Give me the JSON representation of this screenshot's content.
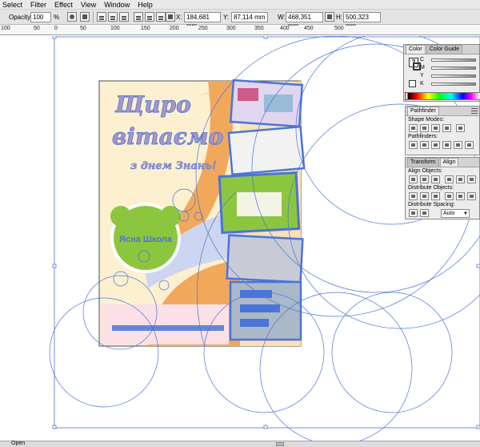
{
  "menu": [
    "Select",
    "Filter",
    "Effect",
    "View",
    "Window",
    "Help"
  ],
  "control": {
    "opacity_label": "Opacity:",
    "opacity_value": "100",
    "opacity_unit": "%",
    "x_label": "X:",
    "x_value": "184,681 mm",
    "y_label": "Y:",
    "y_value": "87,114 mm",
    "w_label": "W:",
    "w_value": "468,351 mm",
    "h_label": "H:",
    "h_value": "500,323 mm"
  },
  "ruler": [
    "100",
    "50",
    "0",
    "50",
    "100",
    "150",
    "200",
    "250",
    "300",
    "350",
    "400",
    "450",
    "500"
  ],
  "artwork": {
    "headline_line1": "Щиро",
    "headline_line2": "вітаємо",
    "subline": "з днем Знань!",
    "badge_text": "Ясна Школа"
  },
  "color_panel": {
    "tabs": [
      "Color",
      "Color Guide"
    ],
    "channels": [
      "C",
      "M",
      "Y",
      "K"
    ]
  },
  "pathfinder_panel": {
    "tab": "Pathfinder",
    "shape_modes_label": "Shape Modes:",
    "pathfinders_label": "Pathfinders:"
  },
  "align_panel": {
    "tabs": [
      "Transform",
      "Align"
    ],
    "align_objects_label": "Align Objects:",
    "distribute_objects_label": "Distribute Objects:",
    "distribute_spacing_label": "Distribute Spacing:",
    "spacing_value": "Auto"
  },
  "status": {
    "text": "Open"
  },
  "colors": {
    "selection": "#4a74d8",
    "poster_bg": "#fdf0d0",
    "orange": "#f2a85a",
    "green": "#8cc63f",
    "lavender": "#cdd5f0"
  }
}
